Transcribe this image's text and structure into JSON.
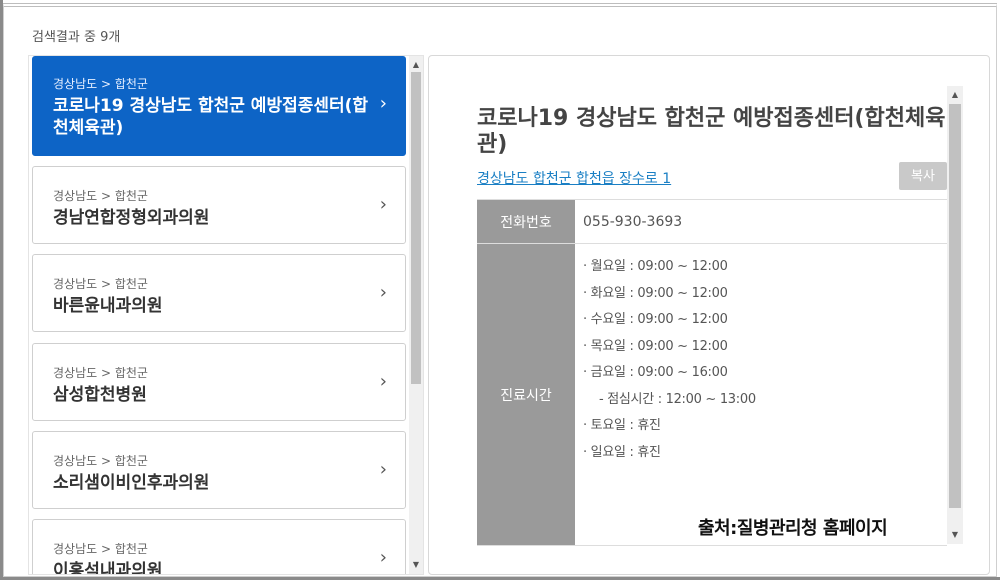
{
  "result_count": "검색결과 중 9개",
  "list": {
    "items": [
      {
        "region": "경상남도 > 합천군",
        "name": "코로나19 경상남도 합천군 예방접종센터(합천체육관)",
        "active": true
      },
      {
        "region": "경상남도 > 합천군",
        "name": "경남연합정형외과의원",
        "active": false
      },
      {
        "region": "경상남도 > 합천군",
        "name": "바른윤내과의원",
        "active": false
      },
      {
        "region": "경상남도 > 합천군",
        "name": "삼성합천병원",
        "active": false
      },
      {
        "region": "경상남도 > 합천군",
        "name": "소리샘이비인후과의원",
        "active": false
      },
      {
        "region": "경상남도 > 합천군",
        "name": "이홍석내과의원",
        "active": false
      }
    ]
  },
  "detail": {
    "title": "코로나19 경상남도 합천군 예방접종센터(합천체육관)",
    "address": "경상남도 합천군 합천읍 장수로 1",
    "copy_label": "복사",
    "phone_label": "전화번호",
    "phone_value": "055-930-3693",
    "hours_label": "진료시간",
    "hours": [
      "· 월요일 : 09:00 ~ 12:00",
      "· 화요일 : 09:00 ~ 12:00",
      "· 수요일 : 09:00 ~ 12:00",
      "· 목요일 : 09:00 ~ 12:00",
      "· 금요일 : 09:00 ~ 16:00",
      "- 점심시간 : 12:00 ~ 13:00",
      "· 토요일 : 휴진",
      "· 일요일 : 휴진"
    ]
  },
  "source_caption": "출처:질병관리청 홈페이지",
  "icons": {
    "chevron": "chevron-right-icon",
    "scroll_up": "scroll-up-arrow-icon",
    "scroll_down": "scroll-down-arrow-icon"
  },
  "colors": {
    "active": "#0d64c6",
    "label_bg": "#9a9a9a",
    "link": "#1a7fc4"
  }
}
